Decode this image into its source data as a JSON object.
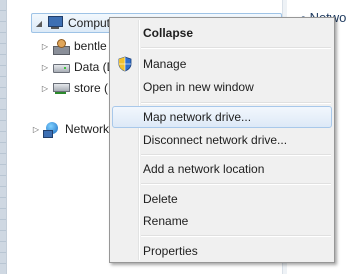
{
  "tree": {
    "computer": "Comput",
    "bentley": "bentle",
    "data": "Data (D",
    "store": "store (",
    "network": "Network"
  },
  "right_pane": {
    "header": "Netwo"
  },
  "context_menu": {
    "items": [
      {
        "label": "Collapse"
      },
      {
        "label": "Manage"
      },
      {
        "label": "Open in new window"
      },
      {
        "label": "Map network drive..."
      },
      {
        "label": "Disconnect network drive..."
      },
      {
        "label": "Add a network location"
      },
      {
        "label": "Delete"
      },
      {
        "label": "Rename"
      },
      {
        "label": "Properties"
      }
    ]
  }
}
